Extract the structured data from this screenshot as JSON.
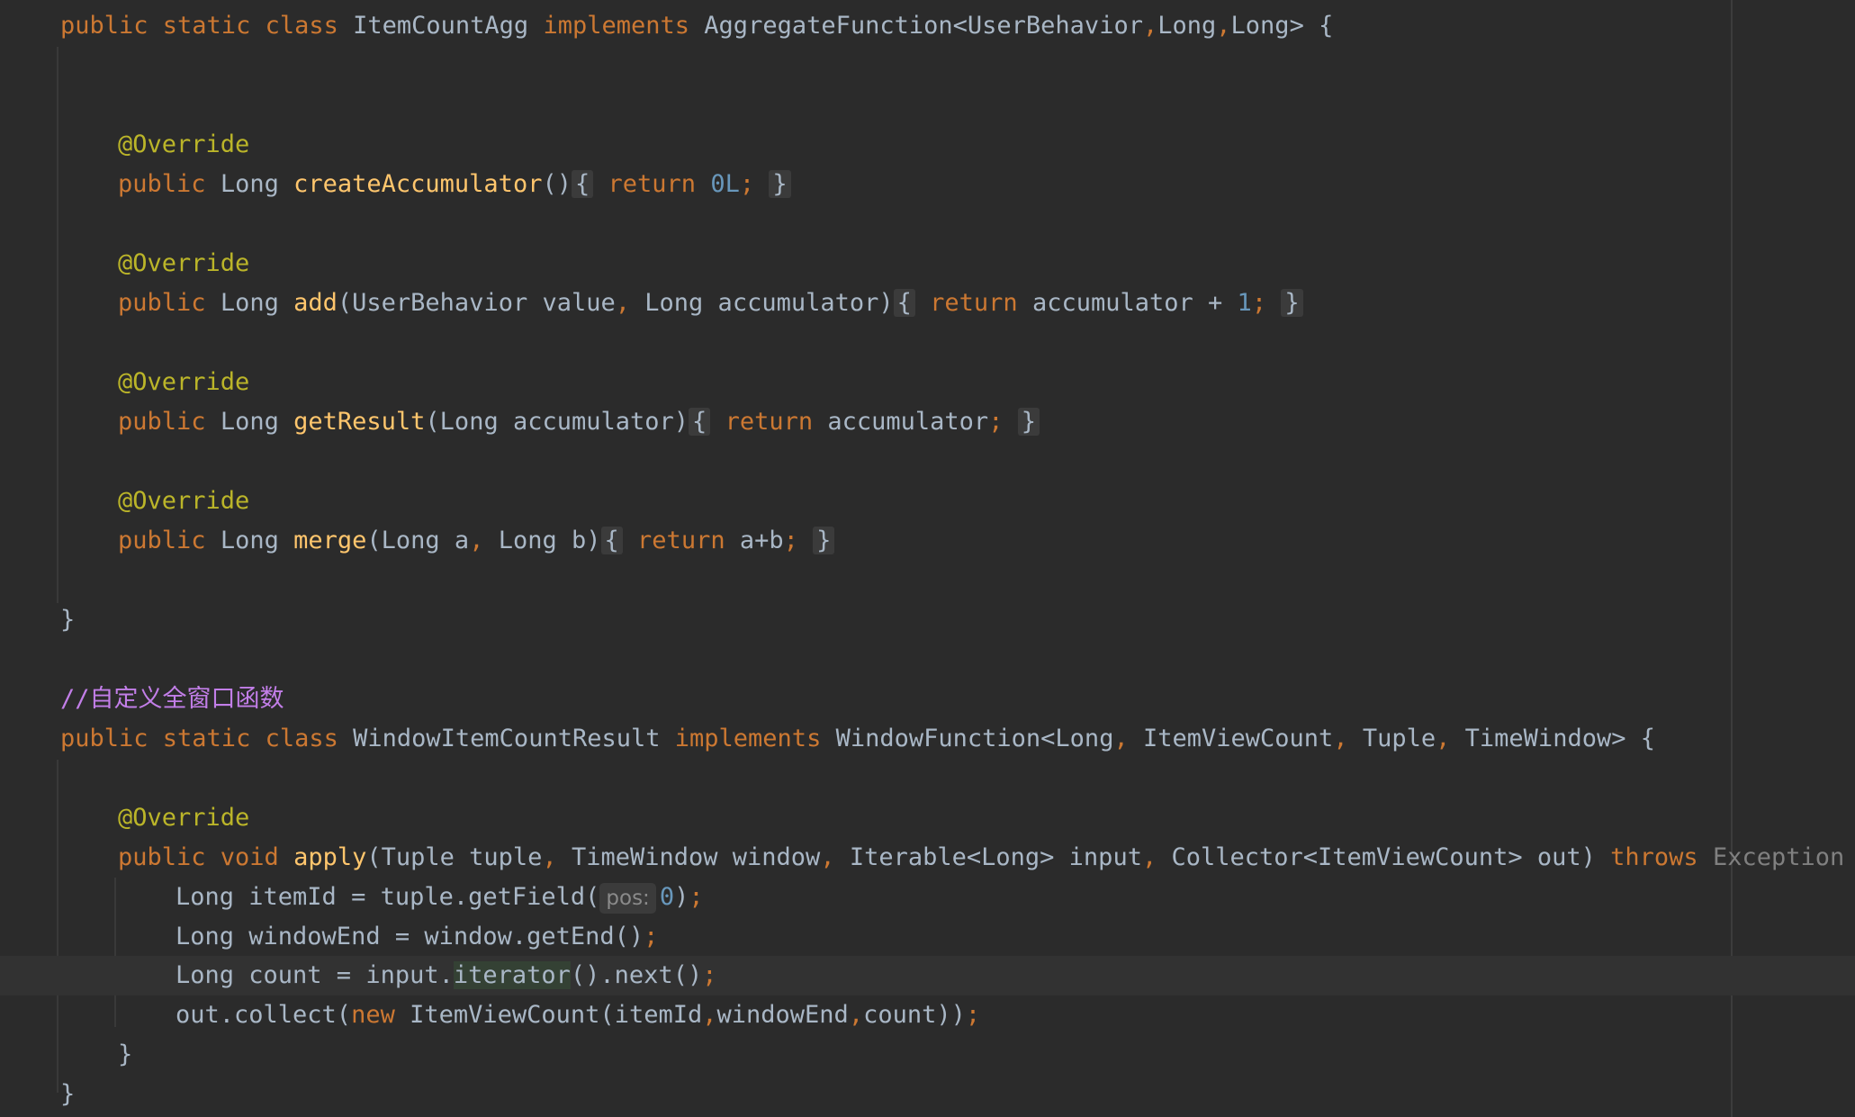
{
  "editor": {
    "colors": {
      "background": "#2b2b2b",
      "keyword": "#cc7832",
      "annotation": "#bbb529",
      "method": "#ffc66d",
      "number": "#6897bb",
      "comment": "#c27ee8",
      "text": "#a9b7c6"
    },
    "class1": {
      "decl_keywords": "public static class",
      "name": "ItemCountAgg",
      "implements_kw": "implements",
      "supertype": "AggregateFunction<UserBehavior",
      "type_arg_long1": "Long",
      "type_arg_long2": "Long",
      "open_brace": "> {",
      "annotation": "@Override",
      "create_acc": {
        "modifier": "public",
        "type": "Long",
        "method": "createAccumulator",
        "params": "()",
        "return_kw": "return",
        "value": "0L"
      },
      "add": {
        "modifier": "public",
        "type": "Long",
        "method": "add",
        "param1": "(UserBehavior value",
        "param2": "Long accumulator)",
        "return_kw": "return",
        "expr": "accumulator + ",
        "value": "1"
      },
      "get_result": {
        "modifier": "public",
        "type": "Long",
        "method": "getResult",
        "params": "(Long accumulator)",
        "return_kw": "return",
        "expr": "accumulator"
      },
      "merge": {
        "modifier": "public",
        "type": "Long",
        "method": "merge",
        "param1": "(Long a",
        "param2": "Long b)",
        "return_kw": "return",
        "expr": "a+b"
      },
      "close_brace": "}"
    },
    "comment": "//自定义全窗口函数",
    "class2": {
      "decl_keywords": "public static class",
      "name": "WindowItemCountResult",
      "implements_kw": "implements",
      "supertype": "WindowFunction<Long",
      "type_arg2": "ItemViewCount",
      "type_arg3": "Tuple",
      "type_arg4": "TimeWindow> {",
      "annotation": "@Override",
      "apply": {
        "modifiers": "public void",
        "method": "apply",
        "param1": "(Tuple tuple",
        "param2": "TimeWindow window",
        "param3": "Iterable<Long> input",
        "param4": "Collector<ItemViewCount> out)",
        "throws_kw": "throws",
        "exception": "Exception",
        "open_brace": "{"
      },
      "body": {
        "line1_prefix": "Long itemId = tuple.getField(",
        "line1_hint": "pos:",
        "line1_arg": "0",
        "line1_suffix": ")",
        "line2": "Long windowEnd = window.getEnd()",
        "line3_prefix": "Long count = input.",
        "line3_highlight": "iterator",
        "line3_suffix": "().next()",
        "line4_prefix": "out.collect(",
        "line4_new": "new",
        "line4_ctor": " ItemViewCount(itemId",
        "line4_arg2": "windowEnd",
        "line4_arg3": "count))"
      },
      "method_close": "}",
      "class_close": "}"
    }
  }
}
